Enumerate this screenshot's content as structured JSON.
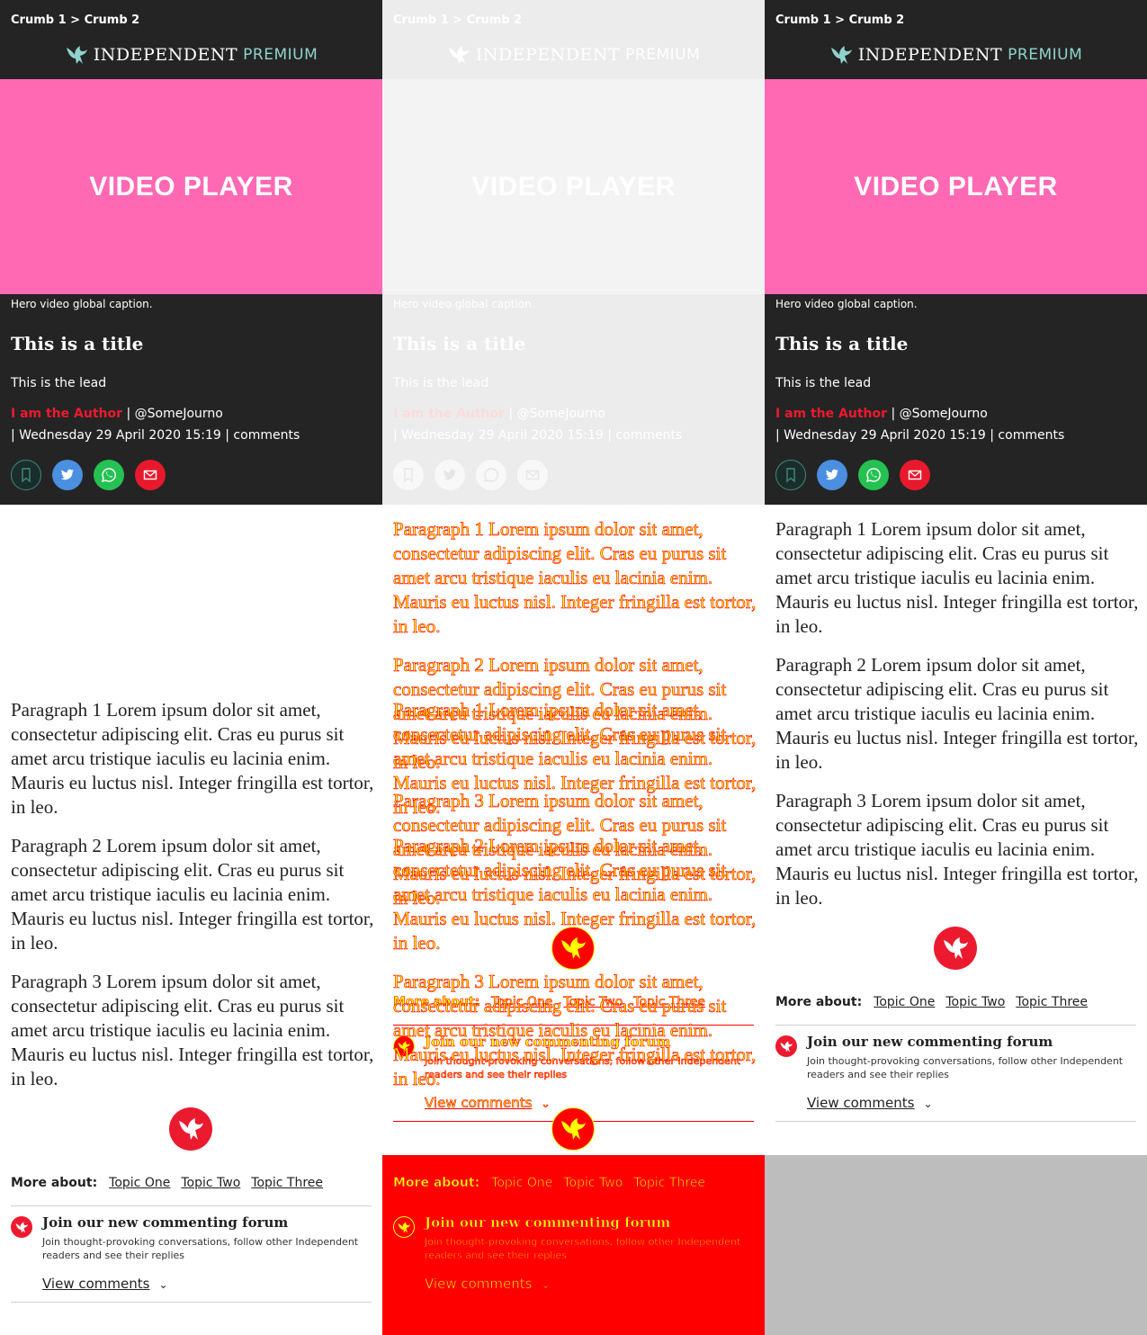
{
  "breadcrumbs": "Crumb 1 > Crumb 2",
  "logo": {
    "word": "INDEPENDENT",
    "premium": "PREMIUM"
  },
  "video": {
    "label": "VIDEO PLAYER",
    "caption": "Hero video global caption."
  },
  "article": {
    "title": "This is a title",
    "lead": "This is the lead",
    "author": "I am the Author",
    "separator": " | ",
    "handle": "@SomeJourno",
    "date_line": "| Wednesday 29 April 2020 15:19 |  comments"
  },
  "share": {
    "bookmark": "bookmark-icon",
    "twitter": "twitter-icon",
    "whatsapp": "whatsapp-icon",
    "email": "email-icon"
  },
  "paragraphs": [
    "Paragraph 1 Lorem ipsum dolor sit amet, consectetur adipiscing elit. Cras eu purus sit amet arcu tristique iaculis eu lacinia enim. Mauris eu luctus nisl. Integer fringilla est tortor, in leo.",
    "Paragraph 2 Lorem ipsum dolor sit amet, consectetur adipiscing elit. Cras eu purus sit amet arcu tristique iaculis eu lacinia enim. Mauris eu luctus nisl. Integer fringilla est tortor, in leo.",
    "Paragraph 3 Lorem ipsum dolor sit amet, consectetur adipiscing elit. Cras eu purus sit amet arcu tristique iaculis eu lacinia enim. Mauris eu luctus nisl. Integer fringilla est tortor, in leo."
  ],
  "more_about": {
    "label": "More about:",
    "topics": [
      "Topic One",
      "Topic Two",
      "Topic Three"
    ]
  },
  "forum": {
    "title": "Join our new commenting forum",
    "description": "Join thought-provoking conversations, follow other Independent readers and see their replies",
    "view_comments": "View comments"
  },
  "colors": {
    "header_bg": "#242424",
    "video_bg": "#ff69b4",
    "accent_red": "#ec1a2e",
    "premium_teal": "#8fd3cc",
    "debug_red": "#ff0000",
    "debug_yellow": "#ffff00",
    "grey_fill": "#bdbdbd"
  }
}
